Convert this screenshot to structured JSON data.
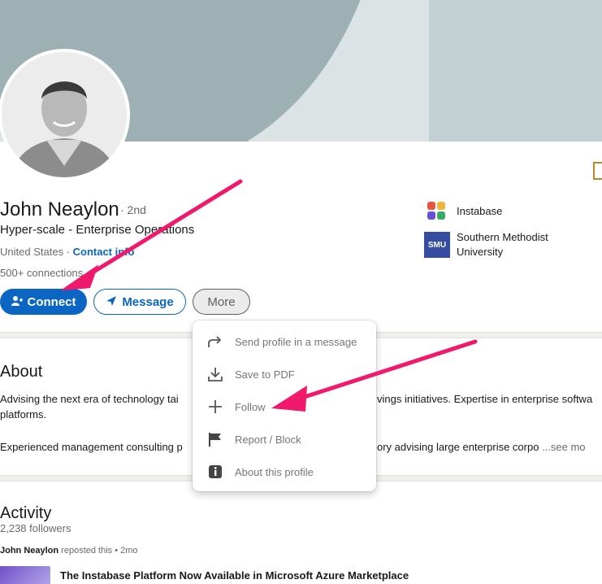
{
  "profile": {
    "name": "John Neaylon",
    "degree": "· 2nd",
    "headline": "Hyper-scale - Enterprise Operations",
    "location": "United States",
    "location_separator": " · ",
    "contact_info": "Contact info",
    "connections": "500+ connections"
  },
  "orgs": [
    {
      "name": "Instabase",
      "logo_colors": [
        "#e8543d",
        "#f2b33d",
        "#6a4fd0",
        "#3aa76d"
      ]
    },
    {
      "name_line1": "Southern Methodist",
      "name_line2": "University",
      "logo_text": "SMU"
    }
  ],
  "actions": {
    "connect": "Connect",
    "message": "Message",
    "more": "More"
  },
  "more_menu": [
    {
      "label": "Send profile in a message",
      "icon": "share-arrow-icon"
    },
    {
      "label": "Save to PDF",
      "icon": "download-icon"
    },
    {
      "label": "Follow",
      "icon": "plus-icon"
    },
    {
      "label": "Report / Block",
      "icon": "flag-icon"
    },
    {
      "label": "About this profile",
      "icon": "info-icon"
    }
  ],
  "about": {
    "title": "About",
    "line1_left": "Advising the next era of technology tai",
    "line1_right": "vings initiatives. Expertise in enterprise softwa",
    "line2": "platforms.",
    "line3_left": "Experienced management consulting p",
    "line3_right": "ory advising large enterprise corpo",
    "see_more": "...see mo"
  },
  "activity": {
    "title": "Activity",
    "followers": "2,238 followers",
    "repost_author": "John Neaylon",
    "repost_text": " reposted this • 2mo",
    "post_title": "The Instabase Platform Now Available in Microsoft Azure Marketplace"
  },
  "colors": {
    "brand_blue": "#0a66c2",
    "annotation_arrow": "#f0196b"
  }
}
